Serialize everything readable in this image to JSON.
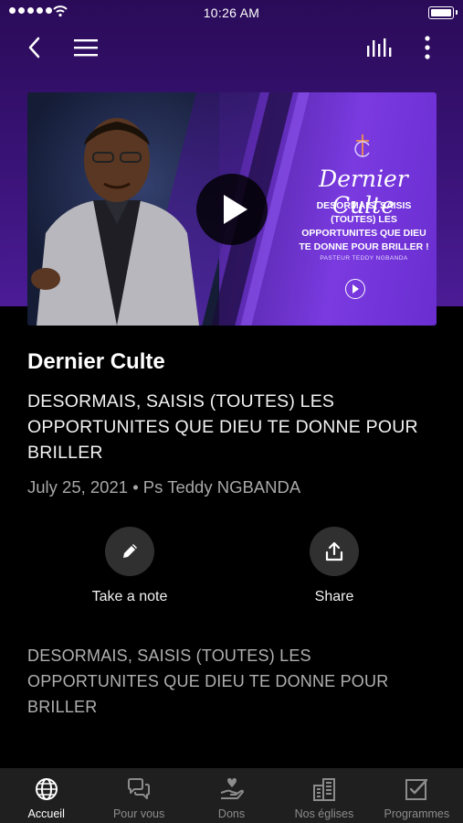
{
  "status_bar": {
    "time": "10:26 AM"
  },
  "hero": {
    "script_title": "Dernier Culte",
    "slogan": "DESORMAIS, SAISIS (TOUTES) LES OPPORTUNITES QUE DIEU TE DONNE POUR BRILLER !",
    "pastor_line": "PASTEUR TEDDY NGBANDA"
  },
  "content": {
    "title": "Dernier Culte",
    "subtitle": "DESORMAIS, SAISIS (TOUTES) LES OPPORTUNITES QUE DIEU TE DONNE POUR BRILLER",
    "meta": "July 25, 2021 • Ps Teddy NGBANDA",
    "description": "DESORMAIS, SAISIS (TOUTES) LES OPPORTUNITES QUE DIEU TE DONNE POUR BRILLER"
  },
  "actions": {
    "note_label": "Take a note",
    "share_label": "Share"
  },
  "tabs": [
    {
      "label": "Accueil",
      "icon": "globe-icon",
      "active": true
    },
    {
      "label": "Pour vous",
      "icon": "chat-bubbles-icon",
      "active": false
    },
    {
      "label": "Dons",
      "icon": "hand-heart-icon",
      "active": false
    },
    {
      "label": "Nos églises",
      "icon": "buildings-icon",
      "active": false
    },
    {
      "label": "Programmes",
      "icon": "checkbox-icon",
      "active": false
    }
  ],
  "colors": {
    "header_gradient_top": "#2a0b58",
    "header_gradient_bottom": "#4b1c96",
    "background": "#000000",
    "tabbar": "#1f1f1f"
  }
}
